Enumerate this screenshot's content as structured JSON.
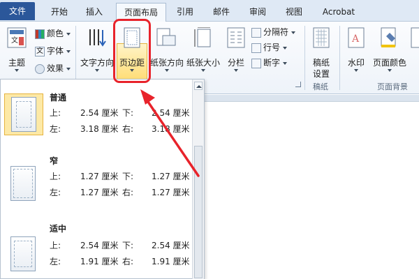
{
  "tabs": [
    "文件",
    "开始",
    "插入",
    "页面布局",
    "引用",
    "邮件",
    "审阅",
    "视图",
    "Acrobat"
  ],
  "ribbon": {
    "theme_group": {
      "theme_label": "主题",
      "colors_label": "颜色",
      "fonts_label": "字体",
      "effects_label": "效果"
    },
    "page_setup": {
      "text_direction": "文字方向",
      "margins": "页边距",
      "orientation": "纸张方向",
      "size": "纸张大小",
      "columns": "分栏",
      "breaks": "分隔符",
      "line_numbers": "行号",
      "hyphenation": "断字"
    },
    "manuscript_group": {
      "manuscript_label": "稿纸",
      "settings_label": "设置",
      "group_label": "稿纸"
    },
    "page_background": {
      "watermark": "水印",
      "page_color": "页面颜色",
      "group_label": "页面背景"
    }
  },
  "margin_presets": [
    {
      "name": "普通",
      "top_label": "上:",
      "top": "2.54 厘米",
      "bottom_label": "下:",
      "bottom": "2.54 厘米",
      "left_label": "左:",
      "left": "3.18 厘米",
      "right_label": "右:",
      "right": "3.18 厘米",
      "selected": true
    },
    {
      "name": "窄",
      "top_label": "上:",
      "top": "1.27 厘米",
      "bottom_label": "下:",
      "bottom": "1.27 厘米",
      "left_label": "左:",
      "left": "1.27 厘米",
      "right_label": "右:",
      "right": "1.27 厘米",
      "selected": false
    },
    {
      "name": "适中",
      "top_label": "上:",
      "top": "2.54 厘米",
      "bottom_label": "下:",
      "bottom": "2.54 厘米",
      "left_label": "左:",
      "left": "1.91 厘米",
      "right_label": "右:",
      "right": "1.91 厘米",
      "selected": false
    }
  ],
  "colors": {
    "file_tab": "#2b579a",
    "highlight": "#ffd968",
    "annotation_red": "#e8232b"
  }
}
